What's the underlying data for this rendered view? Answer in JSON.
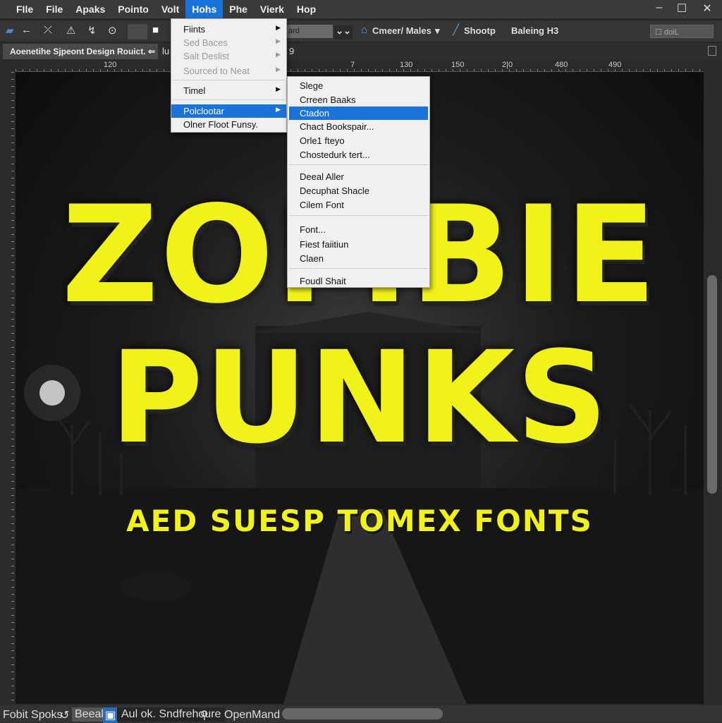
{
  "menubar": {
    "items": [
      "FIle",
      "File",
      "Apaks",
      "Pointo",
      "Volt",
      "Hohs",
      "Phe",
      "Vierk",
      "Hop"
    ],
    "active_index": 5
  },
  "window_controls": {
    "minimize": "–",
    "maximize": "☐",
    "close": "✕"
  },
  "toolbar": {
    "dropdown_value": "ard",
    "camera_label": "Cmeer/ Males",
    "shoot_label": "Shootp",
    "baking_label": "Baleing H3",
    "search_value": "doiL"
  },
  "tabs": {
    "document": "Aoenetihe Sjpeont Design Rouict.",
    "second": "lu",
    "third": "9"
  },
  "ruler": {
    "labels": [
      "120",
      "7",
      "130",
      "150",
      "2|0",
      "480",
      "490"
    ]
  },
  "canvas": {
    "line1": "ZOMBIE",
    "line2": "PUNKS",
    "subtitle": "AED SUESP TOMEX FONTS",
    "text_color": "#f0f21a"
  },
  "menu": {
    "items": [
      {
        "label": "Fiints",
        "disabled": false,
        "submenu": true
      },
      {
        "label": "Sed Baces",
        "disabled": true,
        "submenu": true
      },
      {
        "label": "Salt Deslist",
        "disabled": true,
        "submenu": true
      },
      {
        "label": "Sourced to Neat",
        "disabled": true,
        "submenu": true
      },
      {
        "label": "Timel",
        "disabled": false,
        "submenu": true
      },
      {
        "label": "Polclootar",
        "disabled": false,
        "submenu": true,
        "highlighted": true
      },
      {
        "label": "Olner Floot Funsy.",
        "disabled": false,
        "submenu": false
      }
    ]
  },
  "submenu": {
    "items": [
      "Slege",
      "Crreen Baaks",
      "Ctadon",
      "Chact Bookspair...",
      "Orle1 fteyo",
      "Chostedurk tert...",
      "Deeal Aller",
      "Decuphat Shacle",
      "Cilem Font",
      "Font...",
      "Fiest faiitiun",
      "Claen",
      "Foudl Shait"
    ],
    "highlighted_index": 2
  },
  "statusbar": {
    "left": "Fobit Spoks",
    "mode": "Beeal",
    "info": "Aul ok. Sndfrehoure",
    "right": "OpenMand"
  },
  "accent_color": "#1a73d9"
}
